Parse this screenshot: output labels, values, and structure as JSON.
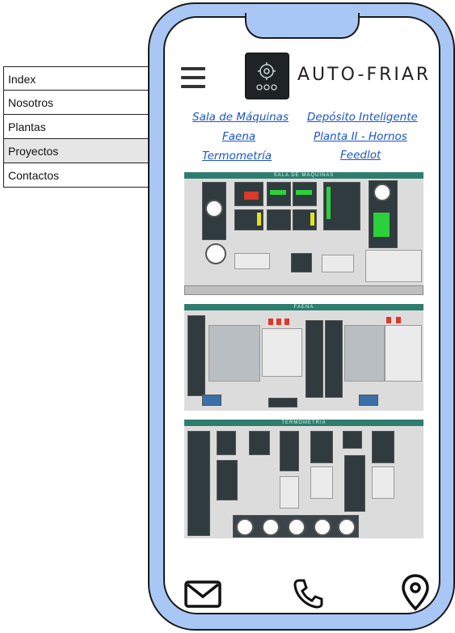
{
  "menu": {
    "items": [
      {
        "label": "Index"
      },
      {
        "label": "Nosotros"
      },
      {
        "label": "Plantas"
      },
      {
        "label": "Proyectos"
      },
      {
        "label": "Contactos"
      }
    ],
    "active": "Proyectos"
  },
  "header": {
    "brand": "AUTO-FRIAR",
    "menu_icon": "hamburger-icon",
    "logo_icon": "gear-logo-icon"
  },
  "links": [
    {
      "label": "Sala de Máquinas"
    },
    {
      "label": "Depósito Inteligente"
    },
    {
      "label": "Faena"
    },
    {
      "label": "Planta II - Hornos"
    },
    {
      "label": "Termometría"
    },
    {
      "label": "Feedlot"
    }
  ],
  "screenshots": [
    {
      "title": "SALA DE MAQUINAS"
    },
    {
      "title": "FAENA"
    },
    {
      "title": "TERMOMETRIA"
    }
  ],
  "footer": {
    "icons": [
      "mail-icon",
      "phone-icon",
      "location-pin-icon"
    ]
  },
  "colors": {
    "phone_frame": "#a9c7f5",
    "link": "#1a55c9",
    "scada_header": "#2f7d6f"
  }
}
